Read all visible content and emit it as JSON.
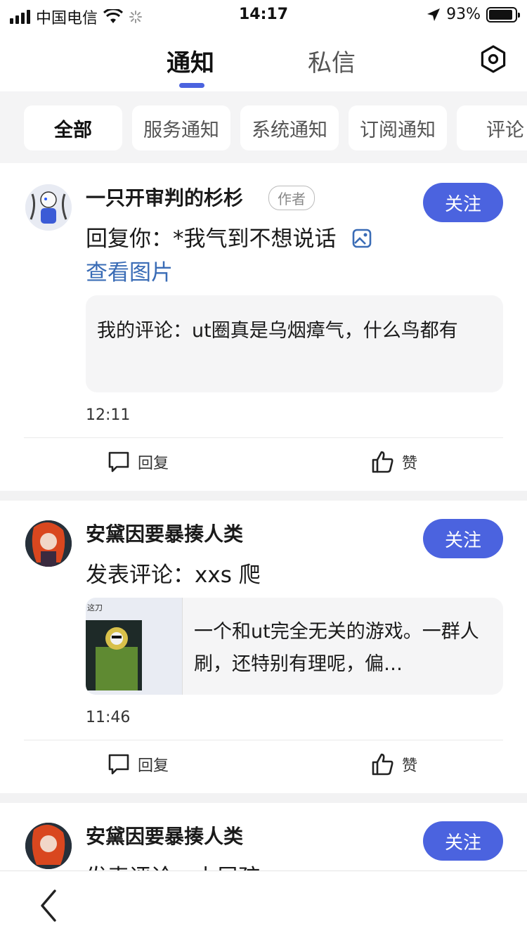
{
  "status_bar": {
    "carrier": "中国电信",
    "time": "14:17",
    "battery": "93%",
    "battery_level": 0.93
  },
  "top_tabs": {
    "notify": "通知",
    "dm": "私信",
    "active": "notify"
  },
  "filters": [
    "全部",
    "服务通知",
    "系统通知",
    "订阅通知",
    "评论"
  ],
  "feed": [
    {
      "user": "一只开审判的杉杉",
      "badge": "作者",
      "follow": "关注",
      "content": "回复你：*我气到不想说话",
      "link": "查看图片",
      "quote": "我的评论：ut圈真是乌烟瘴气，什么鸟都有",
      "time": "12:11",
      "reply": "回复",
      "like": "赞"
    },
    {
      "user": "安黛因要暴揍人类",
      "follow": "关注",
      "content": "发表评论：xxs 爬",
      "quote": "一个和ut完全无关的游戏。一群人刷，还特别有理呢，偏…",
      "thumb_caption": "这刀",
      "time": "11:46",
      "reply": "回复",
      "like": "赞"
    },
    {
      "user": "安黛因要暴揍人类",
      "follow": "关注",
      "content": "发表评论：小屁孩"
    }
  ],
  "colors": {
    "accent": "#4b63df",
    "link": "#3a6cb6",
    "divider": "#f2f2f3"
  }
}
